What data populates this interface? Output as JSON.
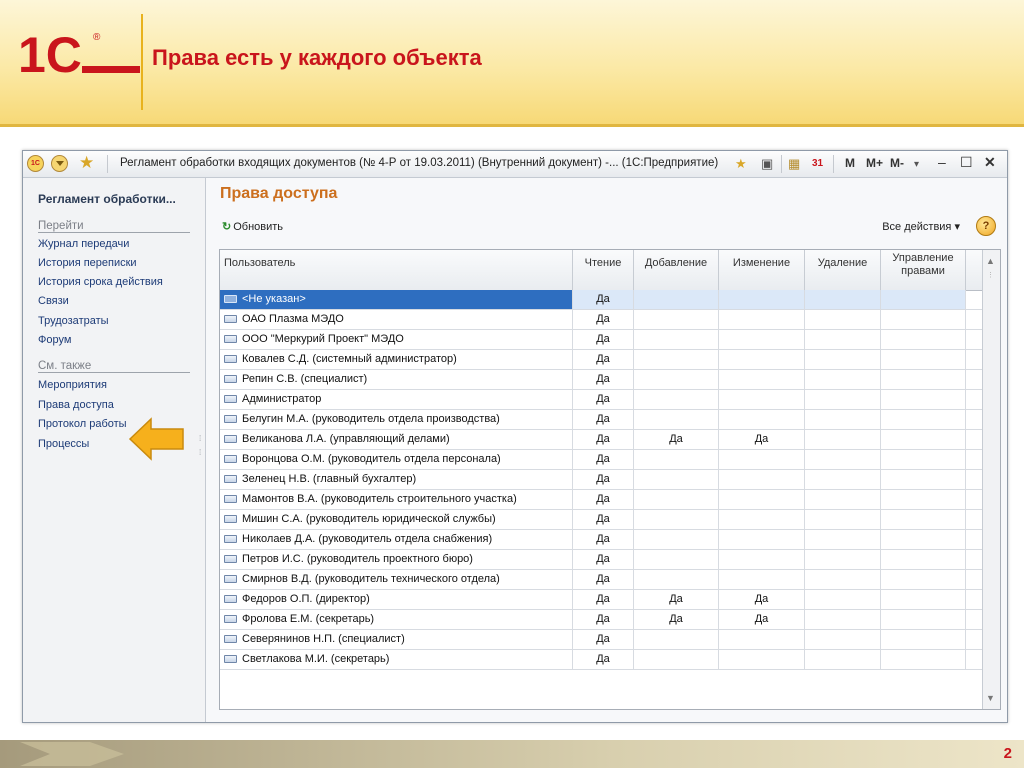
{
  "slide": {
    "logo_text": "1С",
    "registered_mark": "®",
    "title": "Права есть у каждого объекта",
    "page_number": "2",
    "colors": {
      "title": "#c9151c",
      "accent": "#e8b21d"
    }
  },
  "window": {
    "icon_1c": "1С",
    "title": "Регламент обработки входящих документов (№ 4-Р от 19.03.2011) (Внутренний документ) -...  (1С:Предприятие)",
    "icons": [
      "1c-logo-icon",
      "dropdown-circle-icon",
      "favorite-star-icon",
      "favorites-add-icon",
      "print-icon",
      "calculator-icon",
      "calendar-icon",
      "minimize-icon",
      "maximize-icon",
      "close-icon"
    ],
    "memory_buttons": [
      "M",
      "M+",
      "M-"
    ],
    "calendar_day": "31"
  },
  "nav": {
    "heading": "Регламент обработки...",
    "go_section": "Перейти",
    "go_items": [
      "Журнал передачи",
      "История переписки",
      "История срока действия",
      "Связи",
      "Трудозатраты",
      "Форум"
    ],
    "see_also_section": "См. также",
    "see_also_items": [
      "Мероприятия",
      "Права доступа",
      "Протокол работы",
      "Процессы"
    ]
  },
  "panel": {
    "title": "Права доступа",
    "refresh_label": "Обновить",
    "all_actions_label": "Все действия",
    "help_label": "?"
  },
  "table": {
    "headers": {
      "user": "Пользователь",
      "read": "Чтение",
      "add": "Добавление",
      "edit": "Изменение",
      "delete": "Удаление",
      "manage": "Управление правами"
    },
    "selected_row": 0,
    "rows": [
      {
        "user": "<Не указан>",
        "read": "Да",
        "add": "",
        "edit": "",
        "delete": "",
        "manage": ""
      },
      {
        "user": "ОАО Плазма МЭДО",
        "read": "Да",
        "add": "",
        "edit": "",
        "delete": "",
        "manage": ""
      },
      {
        "user": "ООО \"Меркурий Проект\" МЭДО",
        "read": "Да",
        "add": "",
        "edit": "",
        "delete": "",
        "manage": ""
      },
      {
        "user": "Ковалев С.Д. (системный администратор)",
        "read": "Да",
        "add": "",
        "edit": "",
        "delete": "",
        "manage": ""
      },
      {
        "user": "Репин С.В. (специалист)",
        "read": "Да",
        "add": "",
        "edit": "",
        "delete": "",
        "manage": ""
      },
      {
        "user": "Администратор",
        "read": "Да",
        "add": "",
        "edit": "",
        "delete": "",
        "manage": ""
      },
      {
        "user": "Белугин М.А. (руководитель отдела производства)",
        "read": "Да",
        "add": "",
        "edit": "",
        "delete": "",
        "manage": ""
      },
      {
        "user": "Великанова Л.А. (управляющий делами)",
        "read": "Да",
        "add": "Да",
        "edit": "Да",
        "delete": "",
        "manage": ""
      },
      {
        "user": "Воронцова О.М. (руководитель отдела персонала)",
        "read": "Да",
        "add": "",
        "edit": "",
        "delete": "",
        "manage": ""
      },
      {
        "user": "Зеленец Н.В. (главный бухгалтер)",
        "read": "Да",
        "add": "",
        "edit": "",
        "delete": "",
        "manage": ""
      },
      {
        "user": "Мамонтов В.А. (руководитель строительного участка)",
        "read": "Да",
        "add": "",
        "edit": "",
        "delete": "",
        "manage": ""
      },
      {
        "user": "Мишин С.А. (руководитель юридической службы)",
        "read": "Да",
        "add": "",
        "edit": "",
        "delete": "",
        "manage": ""
      },
      {
        "user": "Николаев Д.А. (руководитель отдела снабжения)",
        "read": "Да",
        "add": "",
        "edit": "",
        "delete": "",
        "manage": ""
      },
      {
        "user": "Петров И.С. (руководитель проектного бюро)",
        "read": "Да",
        "add": "",
        "edit": "",
        "delete": "",
        "manage": ""
      },
      {
        "user": "Смирнов В.Д. (руководитель технического отдела)",
        "read": "Да",
        "add": "",
        "edit": "",
        "delete": "",
        "manage": ""
      },
      {
        "user": "Федоров О.П. (директор)",
        "read": "Да",
        "add": "Да",
        "edit": "Да",
        "delete": "",
        "manage": ""
      },
      {
        "user": "Фролова Е.М. (секретарь)",
        "read": "Да",
        "add": "Да",
        "edit": "Да",
        "delete": "",
        "manage": ""
      },
      {
        "user": "Северянинов Н.П. (специалист)",
        "read": "Да",
        "add": "",
        "edit": "",
        "delete": "",
        "manage": ""
      },
      {
        "user": "Светлакова М.И. (секретарь)",
        "read": "Да",
        "add": "",
        "edit": "",
        "delete": "",
        "manage": ""
      }
    ]
  }
}
